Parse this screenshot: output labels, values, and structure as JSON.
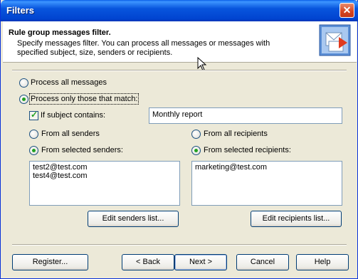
{
  "window": {
    "title": "Filters"
  },
  "header": {
    "title": "Rule group messages filter.",
    "description": "Specify messages filter. You can process all messages or messages with specified subject, size, senders or recipients."
  },
  "mode": {
    "all_label": "Process all messages",
    "match_label": "Process only those that match:",
    "selected": "match"
  },
  "subject": {
    "checkbox_label": "If subject contains:",
    "checked": true,
    "value": "Monthly report"
  },
  "senders": {
    "all_label": "From all senders",
    "selected_label": "From selected senders:",
    "selected": "selected",
    "items": [
      "test2@test.com",
      "test4@test.com"
    ],
    "edit_button": "Edit senders list..."
  },
  "recipients": {
    "all_label": "From all recipients",
    "selected_label": "From selected recipients:",
    "selected": "selected",
    "items": [
      "marketing@test.com"
    ],
    "edit_button": "Edit recipients list..."
  },
  "footer": {
    "register": "Register...",
    "back": "< Back",
    "next": "Next >",
    "cancel": "Cancel",
    "help": "Help"
  }
}
